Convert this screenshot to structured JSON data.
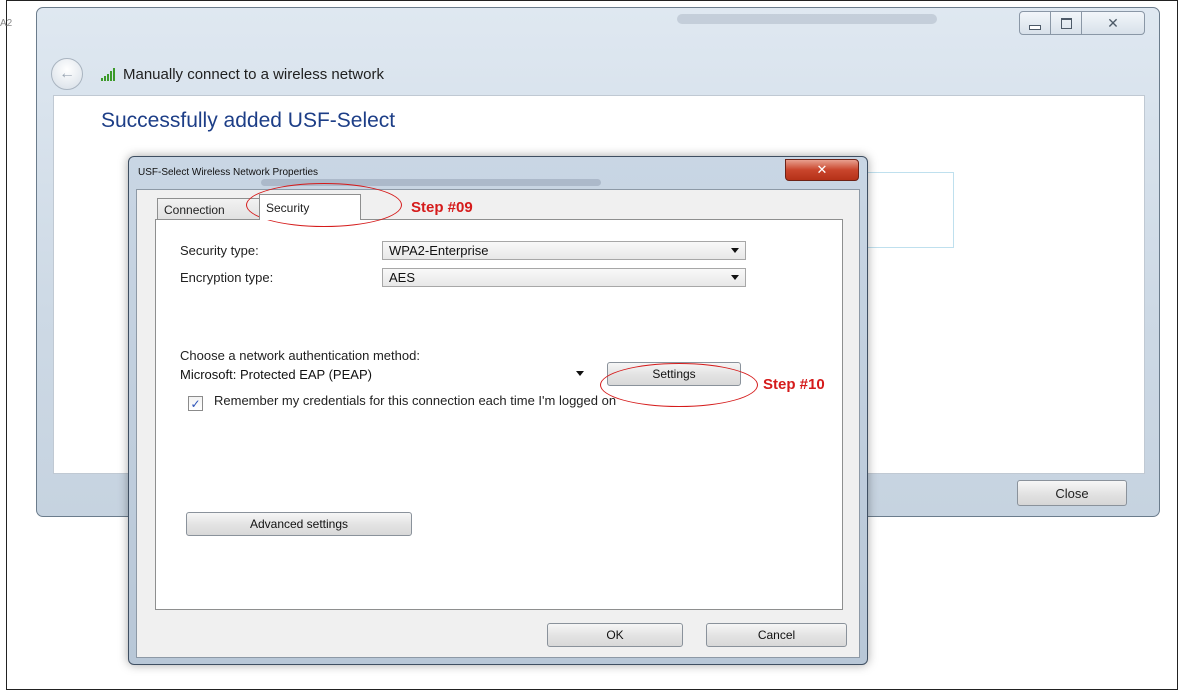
{
  "crop_label": "A2",
  "wizard": {
    "nav_title": "Manually connect to a wireless network",
    "success_title": "Successfully added USF-Select",
    "close_label": "Close",
    "window_controls": {
      "close_glyph": "✕"
    }
  },
  "dialog": {
    "title": "USF-Select Wireless Network Properties",
    "close_glyph": "✕",
    "tabs": [
      {
        "label": "Connection",
        "selected": false
      },
      {
        "label": "Security",
        "selected": true
      }
    ],
    "security_type": {
      "label": "Security type:",
      "value": "WPA2-Enterprise"
    },
    "encryption_type": {
      "label": "Encryption type:",
      "value": "AES"
    },
    "auth": {
      "label": "Choose a network authentication method:",
      "value": "Microsoft: Protected EAP (PEAP)",
      "settings_label": "Settings"
    },
    "remember": {
      "checked": true,
      "label": "Remember my credentials for this connection each time I'm logged on"
    },
    "advanced_label": "Advanced settings",
    "ok_label": "OK",
    "cancel_label": "Cancel"
  },
  "annotations": {
    "step9": "Step #09",
    "step10": "Step #10"
  },
  "colors": {
    "annotation": "#d51b1b",
    "title_blue": "#1d3e87"
  }
}
